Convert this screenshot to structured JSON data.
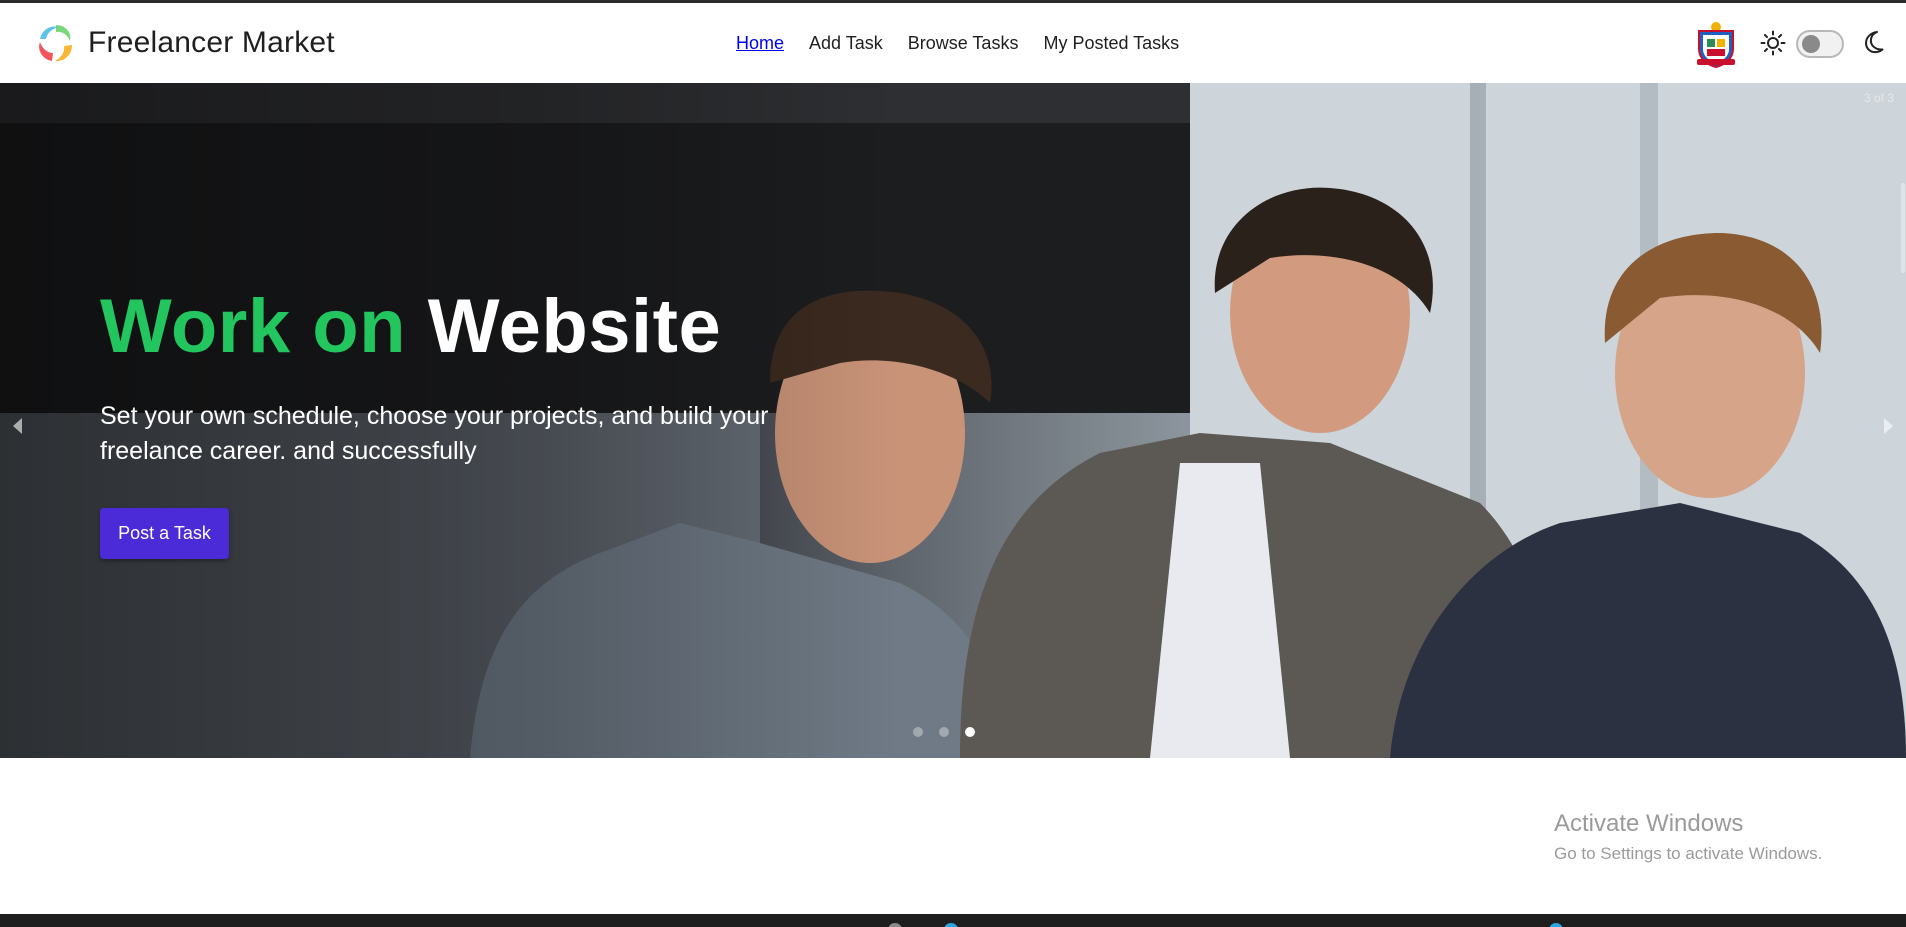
{
  "brand": {
    "name": "Freelancer Market",
    "logo_icon": "swirl-logo-icon"
  },
  "nav": {
    "links": [
      {
        "label": "Home",
        "active": true
      },
      {
        "label": "Add Task",
        "active": false
      },
      {
        "label": "Browse Tasks",
        "active": false
      },
      {
        "label": "My Posted Tasks",
        "active": false
      }
    ],
    "profile_icon": "crest-avatar-icon",
    "theme": {
      "light_icon": "sun-icon",
      "dark_icon": "moon-icon",
      "toggle_on": false
    }
  },
  "hero": {
    "counter": "3 of 3",
    "title_highlight": "Work on",
    "title_rest": "Website",
    "description": "Set your own schedule, choose your projects, and build your freelance career. and successfully",
    "button_label": "Post a Task",
    "slides_total": 3,
    "active_slide": 3
  },
  "watermark": {
    "title": "Activate Windows",
    "subtitle": "Go to Settings to activate Windows."
  },
  "colors": {
    "accent_green": "#22c55e",
    "button_purple": "#4b2bd8",
    "active_link": "#0000ee"
  }
}
